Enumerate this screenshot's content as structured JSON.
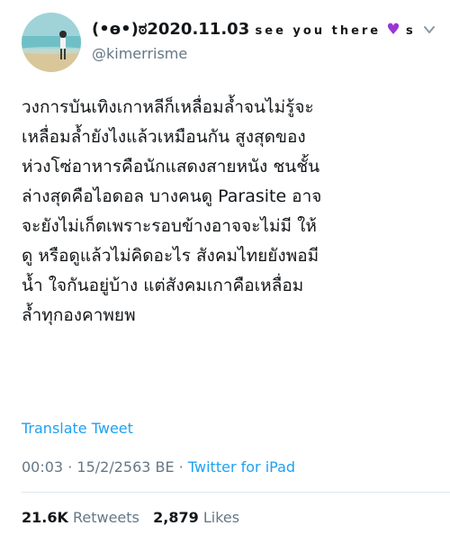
{
  "user": {
    "display_name": "(•ɵ•)ಠ2020.11.03",
    "display_name_suffix": "see you there",
    "heart_icon": "purple-heart-icon",
    "display_name_tail": "s...",
    "handle": "@kimerrisme"
  },
  "tweet": {
    "text": "วงการบันเทิงเกาหลีก็เหลื่อมล้ำจนไม่รู้จะ\nเหลื่อมล้ำยังไงแล้วเหมือนกัน สูงสุดของ\nห่วงโซ่อาหารคือนักแสดงสายหนัง ชนชั้น\nล่างสุดคือไอดอล บางคนดู Parasite อาจ\nจะยังไม่เก็ตเพราะรอบข้างอาจจะไม่มี ให้\nดู หรือดูแล้วไม่คิดอะไร สังคมไทยยังพอมี\nน้ำ ใจกันอยู่บ้าง แต่สังคมเกาคือเหลื่อม\nล้ำทุกองคาพยพ",
    "translate_label": "Translate Tweet",
    "time": "00:03",
    "date": "15/2/2563 BE",
    "separator": "·",
    "source": "Twitter for iPad"
  },
  "stats": {
    "retweets_count": "21.6K",
    "retweets_label": "Retweets",
    "likes_count": "2,879",
    "likes_label": "Likes"
  },
  "colors": {
    "link": "#1da1f2",
    "secondary": "#657786",
    "heart": "#9b35d6"
  }
}
